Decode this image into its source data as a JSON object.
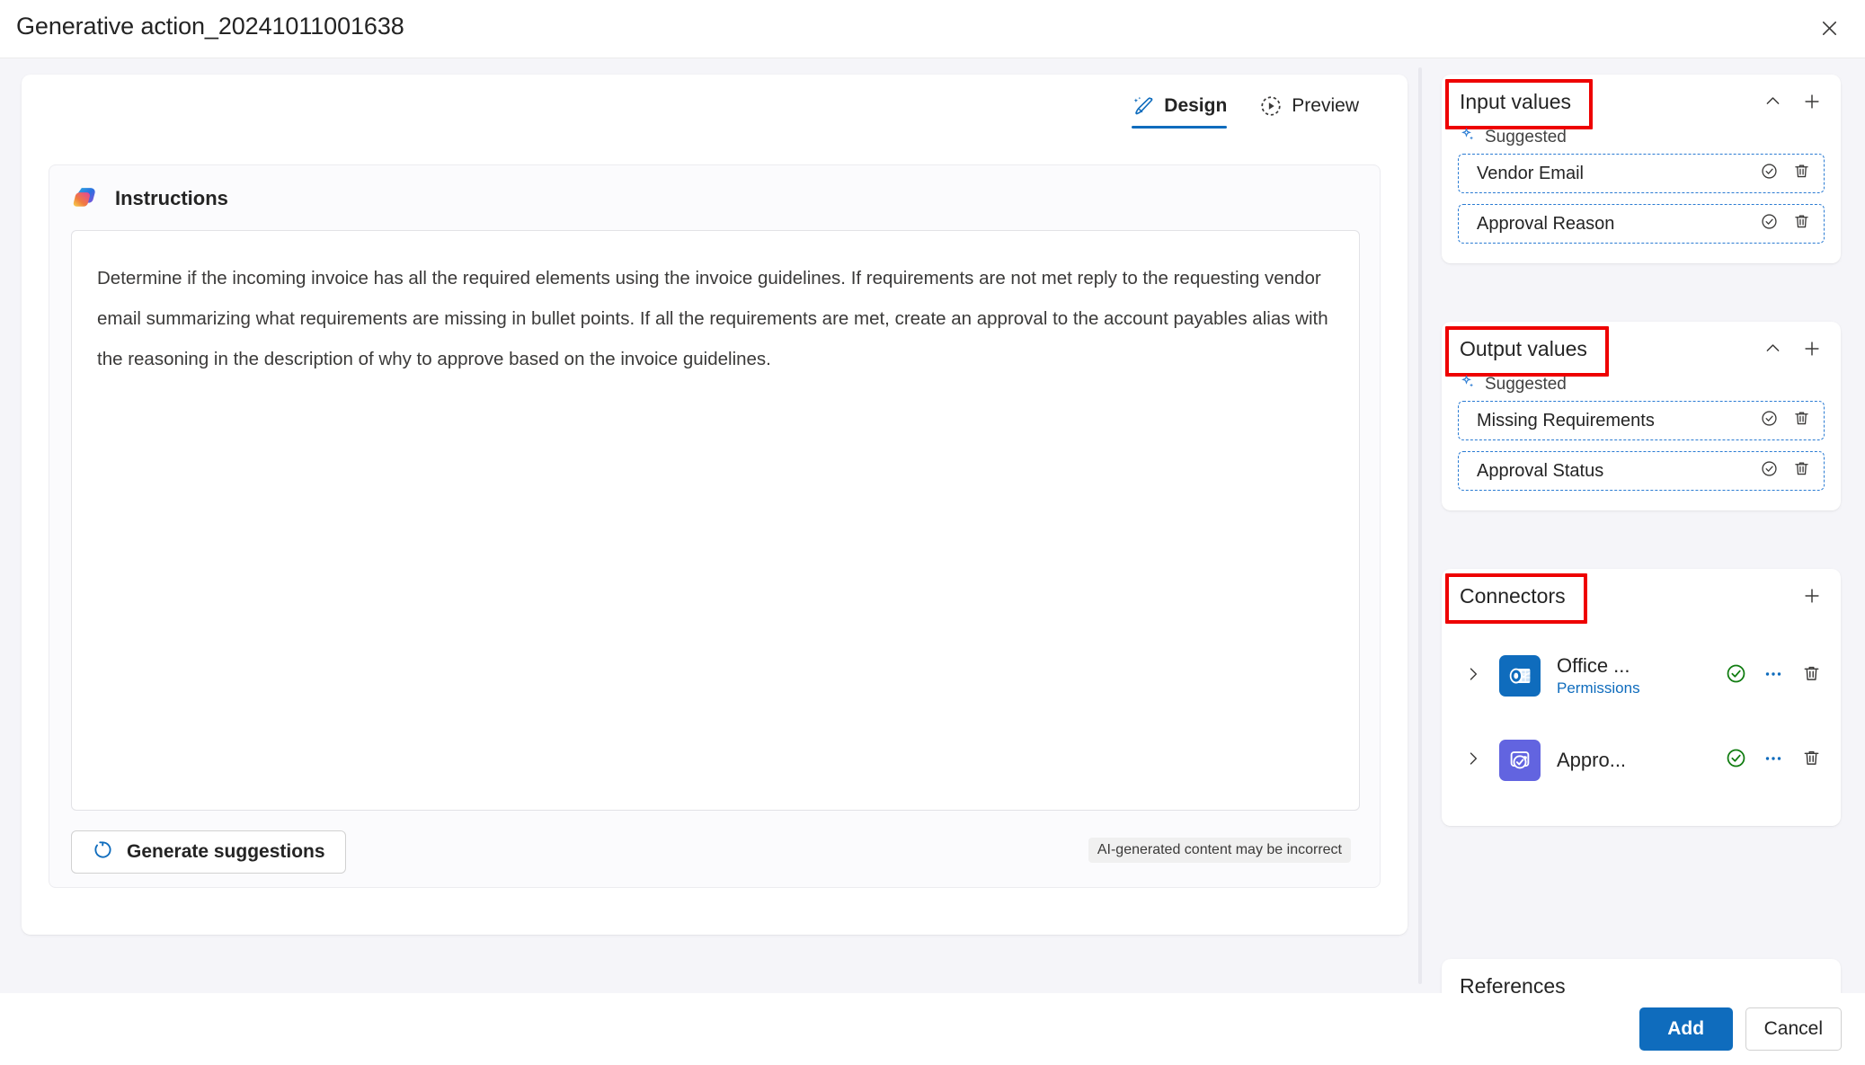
{
  "header": {
    "title": "Generative action_20241011001638",
    "close_icon": "close-icon"
  },
  "tabs": [
    {
      "label": "Design",
      "icon": "sparkle-wand-icon",
      "active": true
    },
    {
      "label": "Preview",
      "icon": "play-circle-dashed-icon",
      "active": false
    }
  ],
  "instructions": {
    "icon": "copilot-icon",
    "title": "Instructions",
    "text": "Determine if the incoming invoice has all the required elements using the invoice guidelines. If requirements are not met reply to the requesting vendor email summarizing what requirements are missing in bullet points. If all the requirements are met, create an approval to the account payables alias with the reasoning in the description of why to approve based on the invoice guidelines.",
    "generate_button": "Generate suggestions",
    "generate_icon": "refresh-circle-icon",
    "disclaimer": "AI-generated content may be incorrect"
  },
  "input_values": {
    "title": "Input values",
    "collapse_icon": "chevron-up-icon",
    "add_icon": "plus-icon",
    "suggested_label": "Suggested",
    "suggested_icon": "sparkle-icon",
    "items": [
      {
        "name": "Vendor Email",
        "accept_icon": "check-circle-icon",
        "delete_icon": "trash-icon"
      },
      {
        "name": "Approval Reason",
        "accept_icon": "check-circle-icon",
        "delete_icon": "trash-icon"
      }
    ]
  },
  "output_values": {
    "title": "Output values",
    "collapse_icon": "chevron-up-icon",
    "add_icon": "plus-icon",
    "suggested_label": "Suggested",
    "suggested_icon": "sparkle-icon",
    "items": [
      {
        "name": "Missing Requirements",
        "accept_icon": "check-circle-icon",
        "delete_icon": "trash-icon"
      },
      {
        "name": "Approval Status",
        "accept_icon": "check-circle-icon",
        "delete_icon": "trash-icon"
      }
    ]
  },
  "connectors": {
    "title": "Connectors",
    "add_icon": "plus-icon",
    "items": [
      {
        "name": "Office ...",
        "sub": "Permissions",
        "tile": "outlook-icon",
        "status_icon": "check-circle-green-icon",
        "more_icon": "more-horizontal-icon",
        "delete_icon": "trash-icon",
        "expand_icon": "chevron-right-icon"
      },
      {
        "name": "Appro...",
        "sub": "",
        "tile": "approvals-icon",
        "status_icon": "check-circle-green-icon",
        "more_icon": "more-horizontal-icon",
        "delete_icon": "trash-icon",
        "expand_icon": "chevron-right-icon"
      }
    ]
  },
  "references": {
    "title": "References"
  },
  "footer": {
    "add_label": "Add",
    "cancel_label": "Cancel"
  },
  "colors": {
    "accent": "#0f6cbd",
    "annotation": "#ee0000",
    "status_ok": "#107c10",
    "suggestion_border": "#2b7cd3",
    "page_bg": "#f5f5f9",
    "approvals_tile": "#6264e0"
  }
}
